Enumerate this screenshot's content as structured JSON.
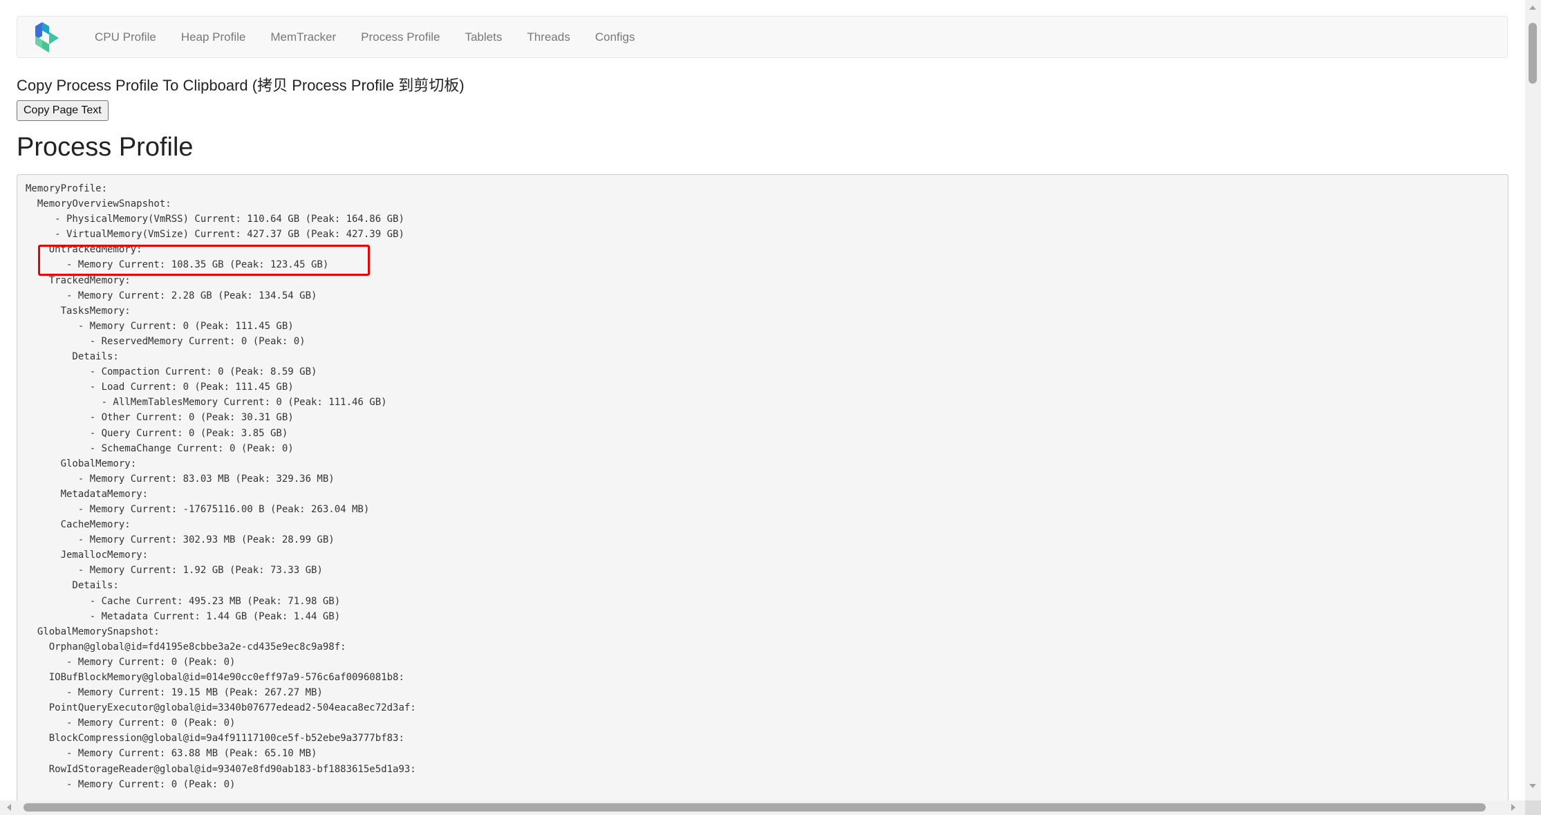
{
  "nav": {
    "logo": "app-logo",
    "items": [
      "CPU Profile",
      "Heap Profile",
      "MemTracker",
      "Process Profile",
      "Tablets",
      "Threads",
      "Configs"
    ]
  },
  "copy_section": {
    "heading": "Copy Process Profile To Clipboard (拷贝 Process Profile 到剪切板)",
    "button_label": "Copy Page Text"
  },
  "profile": {
    "title": "Process Profile",
    "highlight_color": "#ee0000",
    "lines": [
      "MemoryProfile:",
      "  MemoryOverviewSnapshot:",
      "     - PhysicalMemory(VmRSS) Current: 110.64 GB (Peak: 164.86 GB)",
      "     - VirtualMemory(VmSize) Current: 427.37 GB (Peak: 427.39 GB)",
      "    UntrackedMemory:",
      "       - Memory Current: 108.35 GB (Peak: 123.45 GB)",
      "    TrackedMemory:",
      "       - Memory Current: 2.28 GB (Peak: 134.54 GB)",
      "      TasksMemory:",
      "         - Memory Current: 0 (Peak: 111.45 GB)",
      "           - ReservedMemory Current: 0 (Peak: 0)",
      "        Details:",
      "           - Compaction Current: 0 (Peak: 8.59 GB)",
      "           - Load Current: 0 (Peak: 111.45 GB)",
      "             - AllMemTablesMemory Current: 0 (Peak: 111.46 GB)",
      "           - Other Current: 0 (Peak: 30.31 GB)",
      "           - Query Current: 0 (Peak: 3.85 GB)",
      "           - SchemaChange Current: 0 (Peak: 0)",
      "      GlobalMemory:",
      "         - Memory Current: 83.03 MB (Peak: 329.36 MB)",
      "      MetadataMemory:",
      "         - Memory Current: -17675116.00 B (Peak: 263.04 MB)",
      "      CacheMemory:",
      "         - Memory Current: 302.93 MB (Peak: 28.99 GB)",
      "      JemallocMemory:",
      "         - Memory Current: 1.92 GB (Peak: 73.33 GB)",
      "        Details:",
      "           - Cache Current: 495.23 MB (Peak: 71.98 GB)",
      "           - Metadata Current: 1.44 GB (Peak: 1.44 GB)",
      "  GlobalMemorySnapshot:",
      "    Orphan@global@id=fd4195e8cbbe3a2e-cd435e9ec8c9a98f:",
      "       - Memory Current: 0 (Peak: 0)",
      "    IOBufBlockMemory@global@id=014e90cc0eff97a9-576c6af0096081b8:",
      "       - Memory Current: 19.15 MB (Peak: 267.27 MB)",
      "    PointQueryExecutor@global@id=3340b07677edead2-504eaca8ec72d3af:",
      "       - Memory Current: 0 (Peak: 0)",
      "    BlockCompression@global@id=9a4f91117100ce5f-b52ebe9a3777bf83:",
      "       - Memory Current: 63.88 MB (Peak: 65.10 MB)",
      "    RowIdStorageReader@global@id=93407e8fd90ab183-bf1883615e5d1a93:",
      "       - Memory Current: 0 (Peak: 0)"
    ]
  }
}
